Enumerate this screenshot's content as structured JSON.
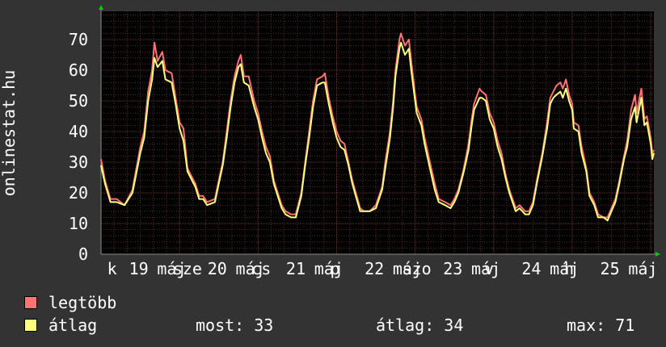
{
  "chart_data": {
    "type": "line",
    "ylabel": "onlinestat.hu",
    "ylim": [
      0,
      70
    ],
    "yticks": [
      0,
      10,
      20,
      30,
      40,
      50,
      60,
      70
    ],
    "xlim": [
      0,
      7.04
    ],
    "x_tick_labels": [
      {
        "x": 0.14,
        "label": "k"
      },
      {
        "x": 0.48,
        "label": "19"
      },
      {
        "x": 0.9,
        "label": "máj"
      },
      {
        "x": 1.1,
        "label": "sze"
      },
      {
        "x": 1.48,
        "label": "20"
      },
      {
        "x": 1.9,
        "label": "máj"
      },
      {
        "x": 2.04,
        "label": "cs"
      },
      {
        "x": 2.48,
        "label": "21"
      },
      {
        "x": 2.9,
        "label": "máj"
      },
      {
        "x": 2.98,
        "label": "p"
      },
      {
        "x": 3.48,
        "label": "22"
      },
      {
        "x": 3.9,
        "label": "máj"
      },
      {
        "x": 4.02,
        "label": "szo"
      },
      {
        "x": 4.48,
        "label": "23"
      },
      {
        "x": 4.9,
        "label": "máj"
      },
      {
        "x": 4.94,
        "label": "v"
      },
      {
        "x": 5.48,
        "label": "24"
      },
      {
        "x": 5.9,
        "label": "máj"
      },
      {
        "x": 5.96,
        "label": "h"
      },
      {
        "x": 6.48,
        "label": "25"
      },
      {
        "x": 6.9,
        "label": "máj"
      }
    ],
    "series": [
      {
        "name": "legtöbb",
        "color": "#ff7373",
        "points": [
          [
            0,
            31
          ],
          [
            0.05,
            24
          ],
          [
            0.12,
            18
          ],
          [
            0.2,
            18
          ],
          [
            0.3,
            16
          ],
          [
            0.4,
            21
          ],
          [
            0.5,
            35
          ],
          [
            0.55,
            40
          ],
          [
            0.6,
            53
          ],
          [
            0.65,
            60
          ],
          [
            0.68,
            69
          ],
          [
            0.72,
            63
          ],
          [
            0.78,
            66
          ],
          [
            0.82,
            60
          ],
          [
            0.9,
            59
          ],
          [
            0.95,
            51
          ],
          [
            1.0,
            43
          ],
          [
            1.05,
            41
          ],
          [
            1.1,
            28
          ],
          [
            1.2,
            23
          ],
          [
            1.25,
            19
          ],
          [
            1.3,
            19
          ],
          [
            1.35,
            17
          ],
          [
            1.45,
            18
          ],
          [
            1.5,
            24
          ],
          [
            1.55,
            30
          ],
          [
            1.6,
            40
          ],
          [
            1.65,
            50
          ],
          [
            1.7,
            58
          ],
          [
            1.75,
            63
          ],
          [
            1.78,
            65
          ],
          [
            1.82,
            58
          ],
          [
            1.88,
            58
          ],
          [
            1.95,
            50
          ],
          [
            2.0,
            46
          ],
          [
            2.05,
            40
          ],
          [
            2.1,
            35
          ],
          [
            2.15,
            32
          ],
          [
            2.2,
            24
          ],
          [
            2.3,
            16
          ],
          [
            2.35,
            14
          ],
          [
            2.42,
            13
          ],
          [
            2.48,
            13
          ],
          [
            2.55,
            20
          ],
          [
            2.6,
            30
          ],
          [
            2.65,
            40
          ],
          [
            2.7,
            50
          ],
          [
            2.75,
            57
          ],
          [
            2.82,
            58
          ],
          [
            2.85,
            59
          ],
          [
            2.9,
            51
          ],
          [
            2.95,
            45
          ],
          [
            3.0,
            40
          ],
          [
            3.05,
            37
          ],
          [
            3.1,
            36
          ],
          [
            3.15,
            30
          ],
          [
            3.2,
            24
          ],
          [
            3.3,
            15
          ],
          [
            3.35,
            14
          ],
          [
            3.42,
            14
          ],
          [
            3.5,
            16
          ],
          [
            3.58,
            22
          ],
          [
            3.62,
            30
          ],
          [
            3.68,
            40
          ],
          [
            3.72,
            50
          ],
          [
            3.75,
            60
          ],
          [
            3.8,
            70
          ],
          [
            3.82,
            72
          ],
          [
            3.87,
            68
          ],
          [
            3.92,
            70
          ],
          [
            3.95,
            63
          ],
          [
            4.0,
            52
          ],
          [
            4.02,
            48
          ],
          [
            4.08,
            44
          ],
          [
            4.12,
            38
          ],
          [
            4.18,
            31
          ],
          [
            4.25,
            23
          ],
          [
            4.3,
            18
          ],
          [
            4.38,
            17
          ],
          [
            4.45,
            16
          ],
          [
            4.5,
            18
          ],
          [
            4.55,
            21
          ],
          [
            4.62,
            28
          ],
          [
            4.68,
            36
          ],
          [
            4.72,
            44
          ],
          [
            4.75,
            49
          ],
          [
            4.82,
            54
          ],
          [
            4.85,
            53
          ],
          [
            4.9,
            52
          ],
          [
            4.95,
            46
          ],
          [
            5.0,
            43
          ],
          [
            5.05,
            37
          ],
          [
            5.1,
            33
          ],
          [
            5.15,
            26
          ],
          [
            5.2,
            21
          ],
          [
            5.28,
            15
          ],
          [
            5.33,
            16
          ],
          [
            5.4,
            14
          ],
          [
            5.45,
            14
          ],
          [
            5.5,
            17
          ],
          [
            5.55,
            24
          ],
          [
            5.62,
            33
          ],
          [
            5.68,
            43
          ],
          [
            5.72,
            51
          ],
          [
            5.76,
            53
          ],
          [
            5.8,
            55
          ],
          [
            5.85,
            56
          ],
          [
            5.88,
            54
          ],
          [
            5.92,
            57
          ],
          [
            5.96,
            52
          ],
          [
            6.0,
            49
          ],
          [
            6.02,
            43
          ],
          [
            6.08,
            42
          ],
          [
            6.12,
            35
          ],
          [
            6.18,
            28
          ],
          [
            6.22,
            20
          ],
          [
            6.28,
            17
          ],
          [
            6.33,
            13
          ],
          [
            6.4,
            12
          ],
          [
            6.45,
            12
          ],
          [
            6.5,
            15
          ],
          [
            6.55,
            18
          ],
          [
            6.6,
            24
          ],
          [
            6.66,
            32
          ],
          [
            6.7,
            37
          ],
          [
            6.75,
            47
          ],
          [
            6.8,
            52
          ],
          [
            6.82,
            46
          ],
          [
            6.88,
            54
          ],
          [
            6.92,
            44
          ],
          [
            6.95,
            45
          ],
          [
            7.0,
            38
          ],
          [
            7.02,
            33
          ],
          [
            7.04,
            34
          ]
        ]
      },
      {
        "name": "átlag",
        "color": "#ffff7f",
        "points": [
          [
            0,
            29
          ],
          [
            0.05,
            23
          ],
          [
            0.12,
            17
          ],
          [
            0.2,
            17
          ],
          [
            0.3,
            16
          ],
          [
            0.4,
            20
          ],
          [
            0.5,
            33
          ],
          [
            0.55,
            38
          ],
          [
            0.6,
            50
          ],
          [
            0.65,
            57
          ],
          [
            0.68,
            64
          ],
          [
            0.72,
            61
          ],
          [
            0.78,
            63
          ],
          [
            0.82,
            57
          ],
          [
            0.9,
            56
          ],
          [
            0.95,
            49
          ],
          [
            1.0,
            41
          ],
          [
            1.05,
            37
          ],
          [
            1.1,
            27
          ],
          [
            1.2,
            22
          ],
          [
            1.25,
            18
          ],
          [
            1.3,
            18
          ],
          [
            1.35,
            16
          ],
          [
            1.45,
            17
          ],
          [
            1.5,
            23
          ],
          [
            1.55,
            29
          ],
          [
            1.6,
            38
          ],
          [
            1.65,
            48
          ],
          [
            1.7,
            56
          ],
          [
            1.75,
            61
          ],
          [
            1.78,
            62
          ],
          [
            1.82,
            56
          ],
          [
            1.88,
            55
          ],
          [
            1.95,
            48
          ],
          [
            2.0,
            44
          ],
          [
            2.05,
            38
          ],
          [
            2.1,
            33
          ],
          [
            2.15,
            30
          ],
          [
            2.2,
            23
          ],
          [
            2.3,
            15
          ],
          [
            2.35,
            13
          ],
          [
            2.42,
            12
          ],
          [
            2.48,
            12
          ],
          [
            2.55,
            19
          ],
          [
            2.6,
            29
          ],
          [
            2.65,
            38
          ],
          [
            2.7,
            48
          ],
          [
            2.75,
            55
          ],
          [
            2.82,
            56
          ],
          [
            2.85,
            56
          ],
          [
            2.9,
            49
          ],
          [
            2.95,
            43
          ],
          [
            3.0,
            38
          ],
          [
            3.05,
            35
          ],
          [
            3.1,
            34
          ],
          [
            3.15,
            29
          ],
          [
            3.2,
            23
          ],
          [
            3.3,
            14
          ],
          [
            3.35,
            14
          ],
          [
            3.42,
            14
          ],
          [
            3.5,
            15
          ],
          [
            3.58,
            21
          ],
          [
            3.62,
            28
          ],
          [
            3.68,
            38
          ],
          [
            3.72,
            48
          ],
          [
            3.75,
            58
          ],
          [
            3.8,
            67
          ],
          [
            3.82,
            69
          ],
          [
            3.87,
            65
          ],
          [
            3.92,
            67
          ],
          [
            3.95,
            60
          ],
          [
            4.0,
            50
          ],
          [
            4.02,
            46
          ],
          [
            4.08,
            42
          ],
          [
            4.12,
            36
          ],
          [
            4.18,
            29
          ],
          [
            4.25,
            21
          ],
          [
            4.3,
            17
          ],
          [
            4.38,
            16
          ],
          [
            4.45,
            15
          ],
          [
            4.5,
            17
          ],
          [
            4.55,
            20
          ],
          [
            4.62,
            27
          ],
          [
            4.68,
            34
          ],
          [
            4.72,
            42
          ],
          [
            4.75,
            47
          ],
          [
            4.82,
            51
          ],
          [
            4.85,
            51
          ],
          [
            4.9,
            50
          ],
          [
            4.95,
            44
          ],
          [
            5.0,
            41
          ],
          [
            5.05,
            35
          ],
          [
            5.1,
            31
          ],
          [
            5.15,
            25
          ],
          [
            5.2,
            20
          ],
          [
            5.28,
            14
          ],
          [
            5.33,
            15
          ],
          [
            5.4,
            13
          ],
          [
            5.45,
            13
          ],
          [
            5.5,
            16
          ],
          [
            5.55,
            23
          ],
          [
            5.62,
            32
          ],
          [
            5.68,
            41
          ],
          [
            5.72,
            49
          ],
          [
            5.76,
            51
          ],
          [
            5.8,
            52
          ],
          [
            5.85,
            53
          ],
          [
            5.88,
            51
          ],
          [
            5.92,
            54
          ],
          [
            5.96,
            50
          ],
          [
            6.0,
            47
          ],
          [
            6.02,
            41
          ],
          [
            6.08,
            40
          ],
          [
            6.12,
            33
          ],
          [
            6.18,
            27
          ],
          [
            6.22,
            19
          ],
          [
            6.28,
            16
          ],
          [
            6.33,
            12
          ],
          [
            6.4,
            12
          ],
          [
            6.45,
            11
          ],
          [
            6.5,
            14
          ],
          [
            6.55,
            17
          ],
          [
            6.6,
            23
          ],
          [
            6.66,
            31
          ],
          [
            6.7,
            35
          ],
          [
            6.75,
            44
          ],
          [
            6.8,
            48
          ],
          [
            6.82,
            43
          ],
          [
            6.88,
            51
          ],
          [
            6.92,
            42
          ],
          [
            6.95,
            43
          ],
          [
            7.0,
            36
          ],
          [
            7.02,
            31
          ],
          [
            7.04,
            33
          ]
        ]
      }
    ],
    "legend": [
      {
        "label": "legtöbb",
        "color": "#ff7373"
      },
      {
        "label": "átlag",
        "color": "#ffff7f"
      }
    ],
    "grid": true
  },
  "stats": {
    "now": "most: 33",
    "avg": "átlag: 34",
    "max": "max: 71"
  },
  "colors": {
    "background": "#333333",
    "plot_background": "#000000",
    "grid_minor": "#5a2a2a",
    "grid_major": "#7a3030",
    "axis_arrow": "#00cc00"
  }
}
